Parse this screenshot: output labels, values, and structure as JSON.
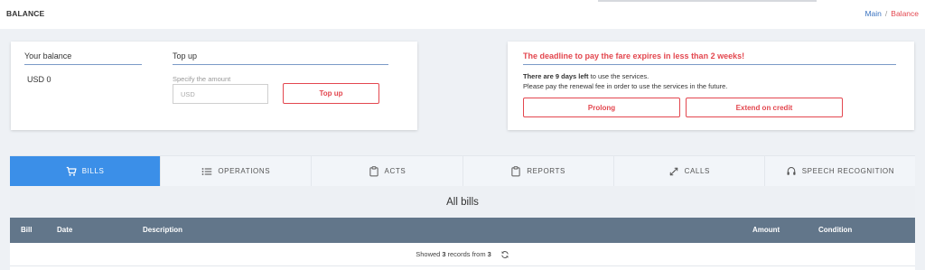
{
  "header": {
    "title": "BALANCE",
    "breadcrumb": {
      "main": "Main",
      "separator": "/",
      "current": "Balance"
    }
  },
  "balance_card": {
    "balance_title": "Your balance",
    "balance_value": "USD 0",
    "topup_title": "Top up",
    "amount_label": "Specify the amount",
    "amount_placeholder": "USD",
    "amount_value": "",
    "topup_button": "Top up"
  },
  "warning_card": {
    "title": "The deadline to pay the fare expires in less than 2 weeks!",
    "line1_bold": "There are 9 days left",
    "line1_rest": " to use the services.",
    "line2": "Please pay the renewal fee in order to use the services in the future.",
    "prolong_button": "Prolong",
    "credit_button": "Extend on credit"
  },
  "tabs": [
    {
      "label": "BILLS",
      "icon": "cart-icon",
      "active": true
    },
    {
      "label": "OPERATIONS",
      "icon": "list-icon",
      "active": false
    },
    {
      "label": "ACTS",
      "icon": "clipboard-icon",
      "active": false
    },
    {
      "label": "REPORTS",
      "icon": "clipboard-icon",
      "active": false
    },
    {
      "label": "CALLS",
      "icon": "arrows-icon",
      "active": false
    },
    {
      "label": "SPEECH RECOGNITION",
      "icon": "headset-icon",
      "active": false
    }
  ],
  "bills_panel": {
    "title": "All bills",
    "columns": [
      "Bill",
      "Date",
      "Description",
      "Amount",
      "Condition"
    ],
    "records_prefix": "Showed ",
    "records_shown": "3",
    "records_middle": " records from ",
    "records_total": "3"
  },
  "colors": {
    "accent": "#3b8fe8",
    "danger": "#e3474f",
    "table_header": "#62768a",
    "link": "#3a73c0"
  }
}
